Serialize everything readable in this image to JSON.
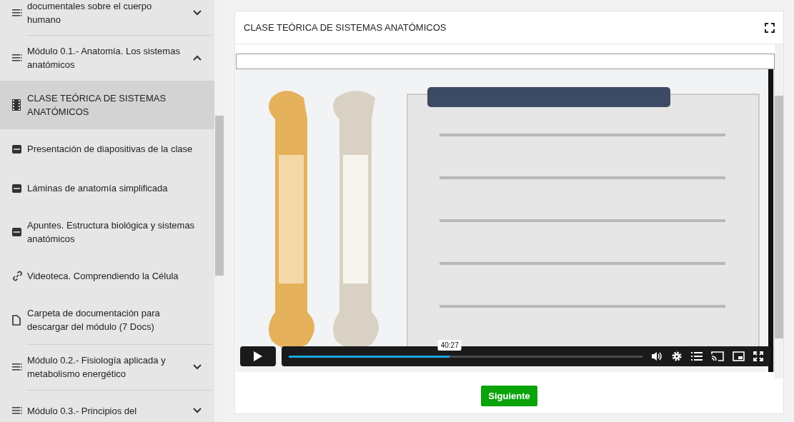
{
  "sidebar": {
    "items": [
      {
        "kind": "module",
        "label": "documentales sobre el cuerpo humano",
        "expanded": false,
        "selected": false
      },
      {
        "kind": "module",
        "label": "Módulo 0.1.- Anatomía. Los sistemas anatómicos",
        "expanded": true,
        "selected": false
      },
      {
        "kind": "video",
        "label": "CLASE TEÓRICA DE SISTEMAS ANATÓMICOS",
        "selected": true
      },
      {
        "kind": "pdf",
        "label": "Presentación de diapositivas de la clase",
        "selected": false
      },
      {
        "kind": "pdf",
        "label": "Láminas de anatomía simplificada",
        "selected": false
      },
      {
        "kind": "pdf",
        "label": "Apuntes. Estructura biológica y sistemas anatómicos",
        "selected": false
      },
      {
        "kind": "link",
        "label": "Videoteca. Comprendiendo la Célula",
        "selected": false
      },
      {
        "kind": "file",
        "label": "Carpeta de documentación para descargar del módulo (7 Docs)",
        "selected": false
      },
      {
        "kind": "module",
        "label": "Módulo 0.2.- Fisiología aplicada y metabolismo energético",
        "expanded": false,
        "selected": false
      },
      {
        "kind": "module",
        "label": "Módulo 0.3.- Principios del",
        "expanded": false,
        "selected": false
      }
    ]
  },
  "lesson": {
    "title": "CLASE TEÓRICA DE SISTEMAS ANATÓMICOS",
    "video": {
      "playing": false,
      "level": 0.455,
      "time": "40:27"
    },
    "next_button": "Siguiente"
  }
}
